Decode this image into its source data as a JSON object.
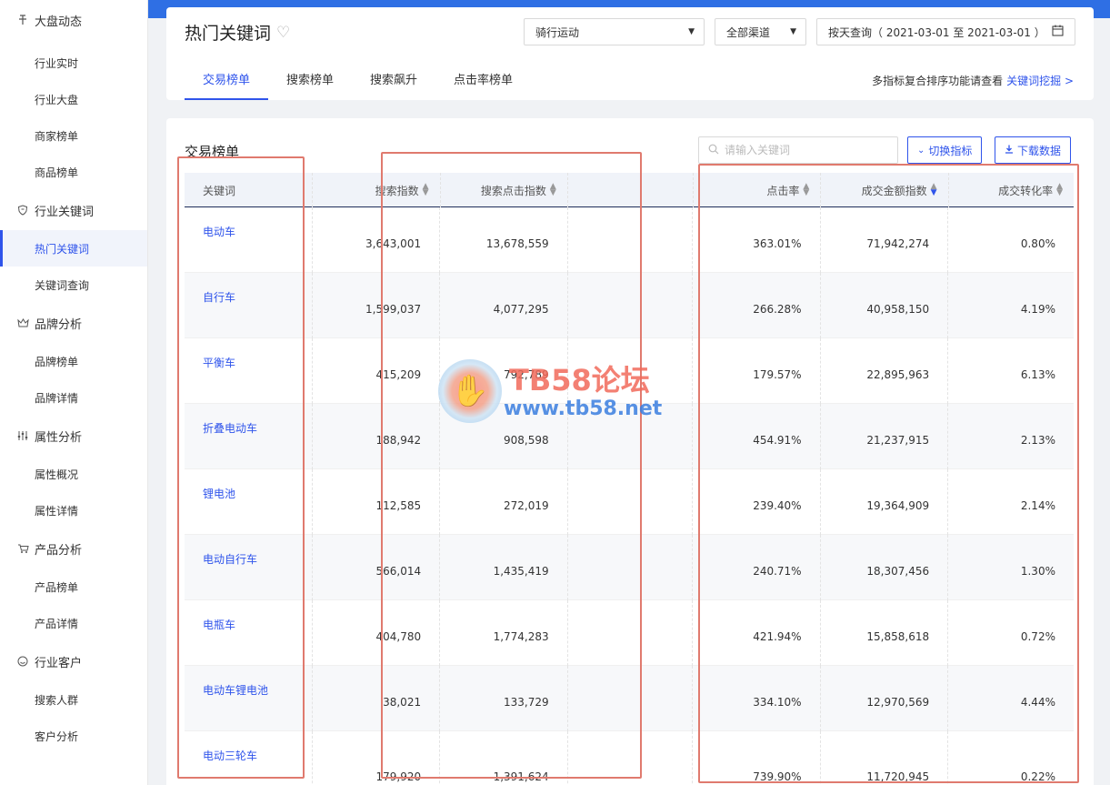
{
  "sidebar": {
    "groups": [
      {
        "title": "大盘动态",
        "icon": "pin-icon",
        "items": [
          "行业实时",
          "行业大盘",
          "商家榜单",
          "商品榜单"
        ]
      },
      {
        "title": "行业关键词",
        "icon": "shield-icon",
        "items": [
          "热门关键词",
          "关键词查询"
        ]
      },
      {
        "title": "品牌分析",
        "icon": "crown-icon",
        "items": [
          "品牌榜单",
          "品牌详情"
        ]
      },
      {
        "title": "属性分析",
        "icon": "sliders-icon",
        "items": [
          "属性概况",
          "属性详情"
        ]
      },
      {
        "title": "产品分析",
        "icon": "cart-icon",
        "items": [
          "产品榜单",
          "产品详情"
        ]
      },
      {
        "title": "行业客户",
        "icon": "smile-icon",
        "items": [
          "搜索人群",
          "客户分析"
        ]
      }
    ],
    "active_item": "热门关键词"
  },
  "header": {
    "title": "热门关键词",
    "category_select": "骑行运动",
    "channel_select": "全部渠道",
    "date_range": "按天查询（ 2021-03-01 至 2021-03-01 ）",
    "tabs": [
      "交易榜单",
      "搜索榜单",
      "搜索飙升",
      "点击率榜单"
    ],
    "active_tab": "交易榜单",
    "tip_text": "多指标复合排序功能请查看",
    "tip_link": "关键词挖掘 >"
  },
  "content": {
    "section_title": "交易榜单",
    "search_placeholder": "请输入关键词",
    "switch_button": "切换指标",
    "download_button": "下载数据",
    "columns": [
      "关键词",
      "搜索指数",
      "搜索点击指数",
      "点击率",
      "成交金额指数",
      "成交转化率"
    ],
    "rows": [
      {
        "keyword": "电动车",
        "search": "3,643,001",
        "click": "13,678,559",
        "ctr": "363.01%",
        "gmv": "71,942,274",
        "cvr": "0.80%"
      },
      {
        "keyword": "自行车",
        "search": "1,599,037",
        "click": "4,077,295",
        "ctr": "266.28%",
        "gmv": "40,958,150",
        "cvr": "4.19%"
      },
      {
        "keyword": "平衡车",
        "search": "415,209",
        "click": "792,789",
        "ctr": "179.57%",
        "gmv": "22,895,963",
        "cvr": "6.13%"
      },
      {
        "keyword": "折叠电动车",
        "search": "188,942",
        "click": "908,598",
        "ctr": "454.91%",
        "gmv": "21,237,915",
        "cvr": "2.13%"
      },
      {
        "keyword": "锂电池",
        "search": "112,585",
        "click": "272,019",
        "ctr": "239.40%",
        "gmv": "19,364,909",
        "cvr": "2.14%"
      },
      {
        "keyword": "电动自行车",
        "search": "566,014",
        "click": "1,435,419",
        "ctr": "240.71%",
        "gmv": "18,307,456",
        "cvr": "1.30%"
      },
      {
        "keyword": "电瓶车",
        "search": "404,780",
        "click": "1,774,283",
        "ctr": "421.94%",
        "gmv": "15,858,618",
        "cvr": "0.72%"
      },
      {
        "keyword": "电动车锂电池",
        "search": "38,021",
        "click": "133,729",
        "ctr": "334.10%",
        "gmv": "12,970,569",
        "cvr": "4.44%"
      },
      {
        "keyword": "电动三轮车",
        "search": "179,920",
        "click": "1,391,624",
        "ctr": "739.90%",
        "gmv": "11,720,945",
        "cvr": "0.22%"
      }
    ]
  },
  "watermark": {
    "line1": "TB58论坛",
    "line2": "www.tb58.net"
  },
  "colors": {
    "accent": "#2f54eb",
    "highlight": "#e07a6e",
    "top_strip": "#2f6fe4"
  }
}
